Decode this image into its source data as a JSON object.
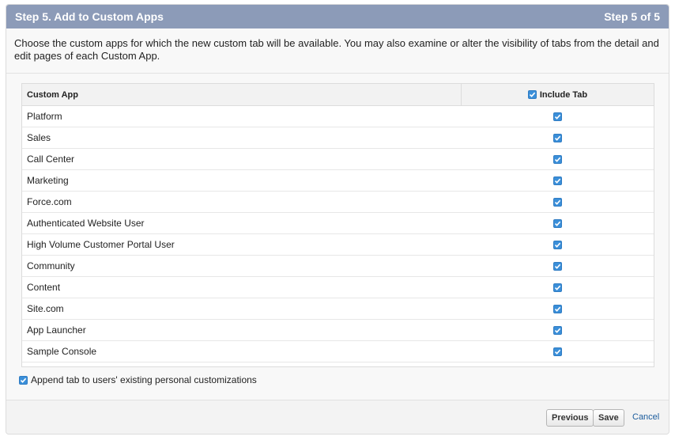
{
  "header": {
    "title": "Step 5. Add to Custom Apps",
    "step": "Step 5 of 5"
  },
  "description": "Choose the custom apps for which the new custom tab will be available. You may also examine or alter the visibility of tabs from the detail and edit pages of each Custom App.",
  "table": {
    "col_app": "Custom App",
    "col_include": "Include Tab",
    "include_all_checked": true,
    "rows": [
      {
        "app": "Platform",
        "checked": true
      },
      {
        "app": "Sales",
        "checked": true
      },
      {
        "app": "Call Center",
        "checked": true
      },
      {
        "app": "Marketing",
        "checked": true
      },
      {
        "app": "Force.com",
        "checked": true
      },
      {
        "app": "Authenticated Website User",
        "checked": true
      },
      {
        "app": "High Volume Customer Portal User",
        "checked": true
      },
      {
        "app": "Community",
        "checked": true
      },
      {
        "app": "Content",
        "checked": true
      },
      {
        "app": "Site.com",
        "checked": true
      },
      {
        "app": "App Launcher",
        "checked": true
      },
      {
        "app": "Sample Console",
        "checked": true
      }
    ]
  },
  "append": {
    "label": "Append tab to users' existing personal customizations",
    "checked": true
  },
  "buttons": {
    "previous": "Previous",
    "save": "Save",
    "cancel": "Cancel"
  },
  "colors": {
    "header_bg": "#8c9bb8",
    "checkbox": "#3b8fd9",
    "link": "#1a5b9c"
  }
}
